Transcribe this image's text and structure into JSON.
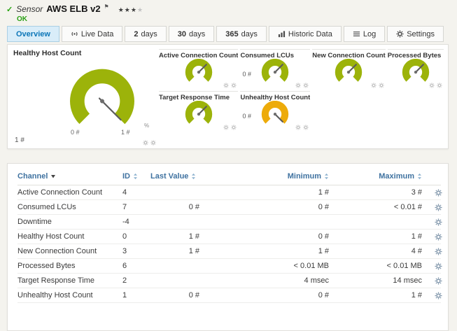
{
  "header": {
    "status_icon": "✓",
    "kind_label": "Sensor",
    "title": "AWS ELB v2",
    "priority_flag": "⚑",
    "stars_filled": "★★★",
    "stars_empty": "★",
    "status": "OK"
  },
  "tabs": [
    {
      "label": "Overview",
      "active": true
    },
    {
      "icon": "live-data-icon",
      "label": "Live Data"
    },
    {
      "num": "2",
      "label": "days"
    },
    {
      "num": "30",
      "label": "days"
    },
    {
      "num": "365",
      "label": "days"
    },
    {
      "icon": "historic-data-icon",
      "label": "Historic Data"
    },
    {
      "icon": "log-icon",
      "label": "Log"
    },
    {
      "icon": "settings-icon",
      "label": "Settings"
    }
  ],
  "overview": {
    "main_gauge": {
      "title": "Healthy Host Count",
      "current_value": "1 #",
      "scale_min": "0 #",
      "scale_max": "1 #",
      "percent_toggle": "%"
    },
    "mini_gauges": [
      {
        "title": "Active Connection Count",
        "value": "",
        "status_color": "green"
      },
      {
        "title": "Consumed LCUs",
        "value": "0 #",
        "status_color": "green"
      },
      {
        "title": "New Connection Count",
        "value": "",
        "status_color": "green"
      },
      {
        "title": "Processed Bytes",
        "value": "",
        "status_color": "green"
      },
      {
        "title": "Target Response Time",
        "value": "",
        "status_color": "green"
      },
      {
        "title": "Unhealthy Host Count",
        "value": "0 #",
        "status_color": "warning"
      }
    ]
  },
  "table": {
    "columns": [
      "Channel",
      "ID",
      "Last Value",
      "Minimum",
      "Maximum"
    ],
    "rows": [
      {
        "channel": "Active Connection Count",
        "id": "4",
        "last": "",
        "min": "1 #",
        "max": "3 #"
      },
      {
        "channel": "Consumed LCUs",
        "id": "7",
        "last": "0 #",
        "min": "0 #",
        "max": "< 0.01 #"
      },
      {
        "channel": "Downtime",
        "id": "-4",
        "last": "",
        "min": "",
        "max": ""
      },
      {
        "channel": "Healthy Host Count",
        "id": "0",
        "last": "1 #",
        "min": "0 #",
        "max": "1 #"
      },
      {
        "channel": "New Connection Count",
        "id": "3",
        "last": "1 #",
        "min": "1 #",
        "max": "4 #"
      },
      {
        "channel": "Processed Bytes",
        "id": "6",
        "last": "",
        "min": "< 0.01 MB",
        "max": "< 0.01 MB"
      },
      {
        "channel": "Target Response Time",
        "id": "2",
        "last": "",
        "min": "4 msec",
        "max": "14 msec"
      },
      {
        "channel": "Unhealthy Host Count",
        "id": "1",
        "last": "0 #",
        "min": "0 #",
        "max": "1 #"
      }
    ]
  },
  "colors": {
    "ok_green": "#2aa015",
    "gauge_green": "#9cb30a",
    "gauge_warning": "#edab0a",
    "active_tab_blue": "#0c76b8",
    "table_header_blue": "#3f72a0"
  }
}
